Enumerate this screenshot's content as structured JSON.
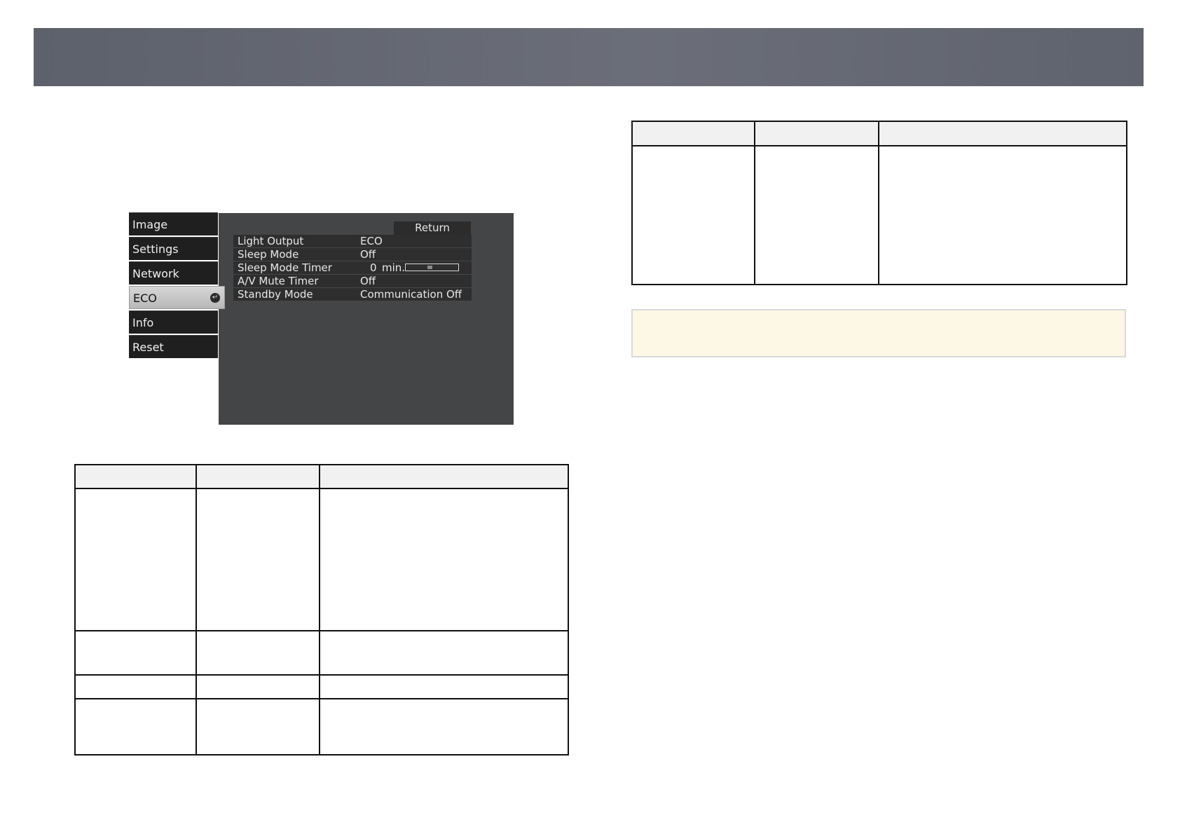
{
  "colors": {
    "header_bar": "#666a73",
    "menu_panel": "#444546",
    "note_background": "#fdf7e5"
  },
  "menu": {
    "tabs": [
      {
        "label": "Image",
        "active": false
      },
      {
        "label": "Settings",
        "active": false
      },
      {
        "label": "Network",
        "active": false
      },
      {
        "label": "ECO",
        "active": true
      },
      {
        "label": "Info",
        "active": false
      },
      {
        "label": "Reset",
        "active": false
      }
    ],
    "return_label": "Return",
    "rows": [
      {
        "label": "Light Output",
        "value": "ECO"
      },
      {
        "label": "Sleep Mode",
        "value": "Off"
      },
      {
        "label": "Sleep Mode Timer",
        "value": "0",
        "unit": "min.",
        "slider_fraction": 0.46
      },
      {
        "label": "A/V Mute Timer",
        "value": "Off"
      },
      {
        "label": "Standby Mode",
        "value": "Communication Off"
      }
    ],
    "enter_icon": "enter-arrow-icon"
  },
  "table_left": {
    "header": [
      "",
      "",
      ""
    ],
    "rows": [
      [
        "",
        "",
        ""
      ],
      [
        "",
        "",
        ""
      ],
      [
        "",
        "",
        ""
      ],
      [
        "",
        "",
        ""
      ]
    ]
  },
  "table_right": {
    "header": [
      "",
      "",
      ""
    ],
    "rows": [
      [
        "",
        "",
        ""
      ]
    ]
  },
  "note": {
    "text": ""
  }
}
